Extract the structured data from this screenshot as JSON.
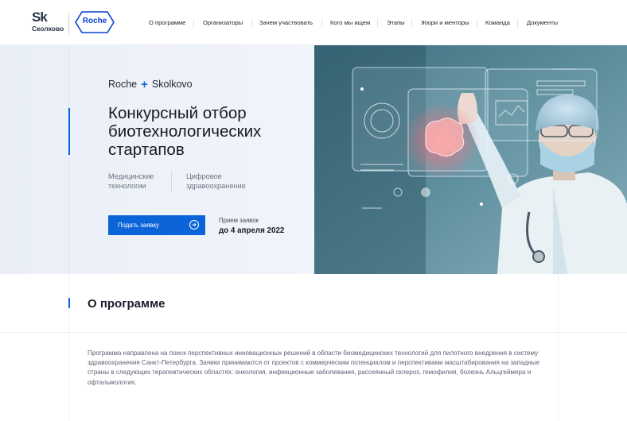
{
  "header": {
    "skolkovo_mark": "Sk",
    "skolkovo_word": "Сколково",
    "roche_logo": "Roche",
    "nav": [
      {
        "label": "О программе"
      },
      {
        "label": "Организаторы"
      },
      {
        "label": "Зачем участвовать"
      },
      {
        "label": "Кого мы ищем"
      },
      {
        "label": "Этапы"
      },
      {
        "label": "Жюри и менторы"
      },
      {
        "label": "Команда"
      },
      {
        "label": "Документы"
      }
    ]
  },
  "hero": {
    "brand_left": "Roche",
    "brand_plus": "+",
    "brand_right": "Skolkovo",
    "title": "Конкурсный отбор биотехнологических стартапов",
    "tags": [
      "Медицинские технологии",
      "Цифровое здравоохранение"
    ],
    "apply_button": "Подать заявку",
    "deadline_label": "Прием заявок",
    "deadline_date": "до 4 апреля 2022"
  },
  "about": {
    "title": "О программе",
    "text": "Программа направлена на поиск перспективных инновационных решений в области биомедицинских технологий для пилотного внедрения в систему здравоохранения Санкт-Петербурга. Заявки принимаются от проектов с коммерческим потенциалом и перспективами масштабирования на западные страны в следующих терапевтических областях: онкология, инфекционные заболевания, рассеянный склероз, гемофилия, болезнь Альцгеймера и офтальмология."
  },
  "colors": {
    "accent": "#0b64d8",
    "roche_blue": "#0b41cd",
    "hero_bg": "#eef2f8"
  },
  "icons": {
    "apply_button_icon": "arrow-right-circle-icon"
  }
}
